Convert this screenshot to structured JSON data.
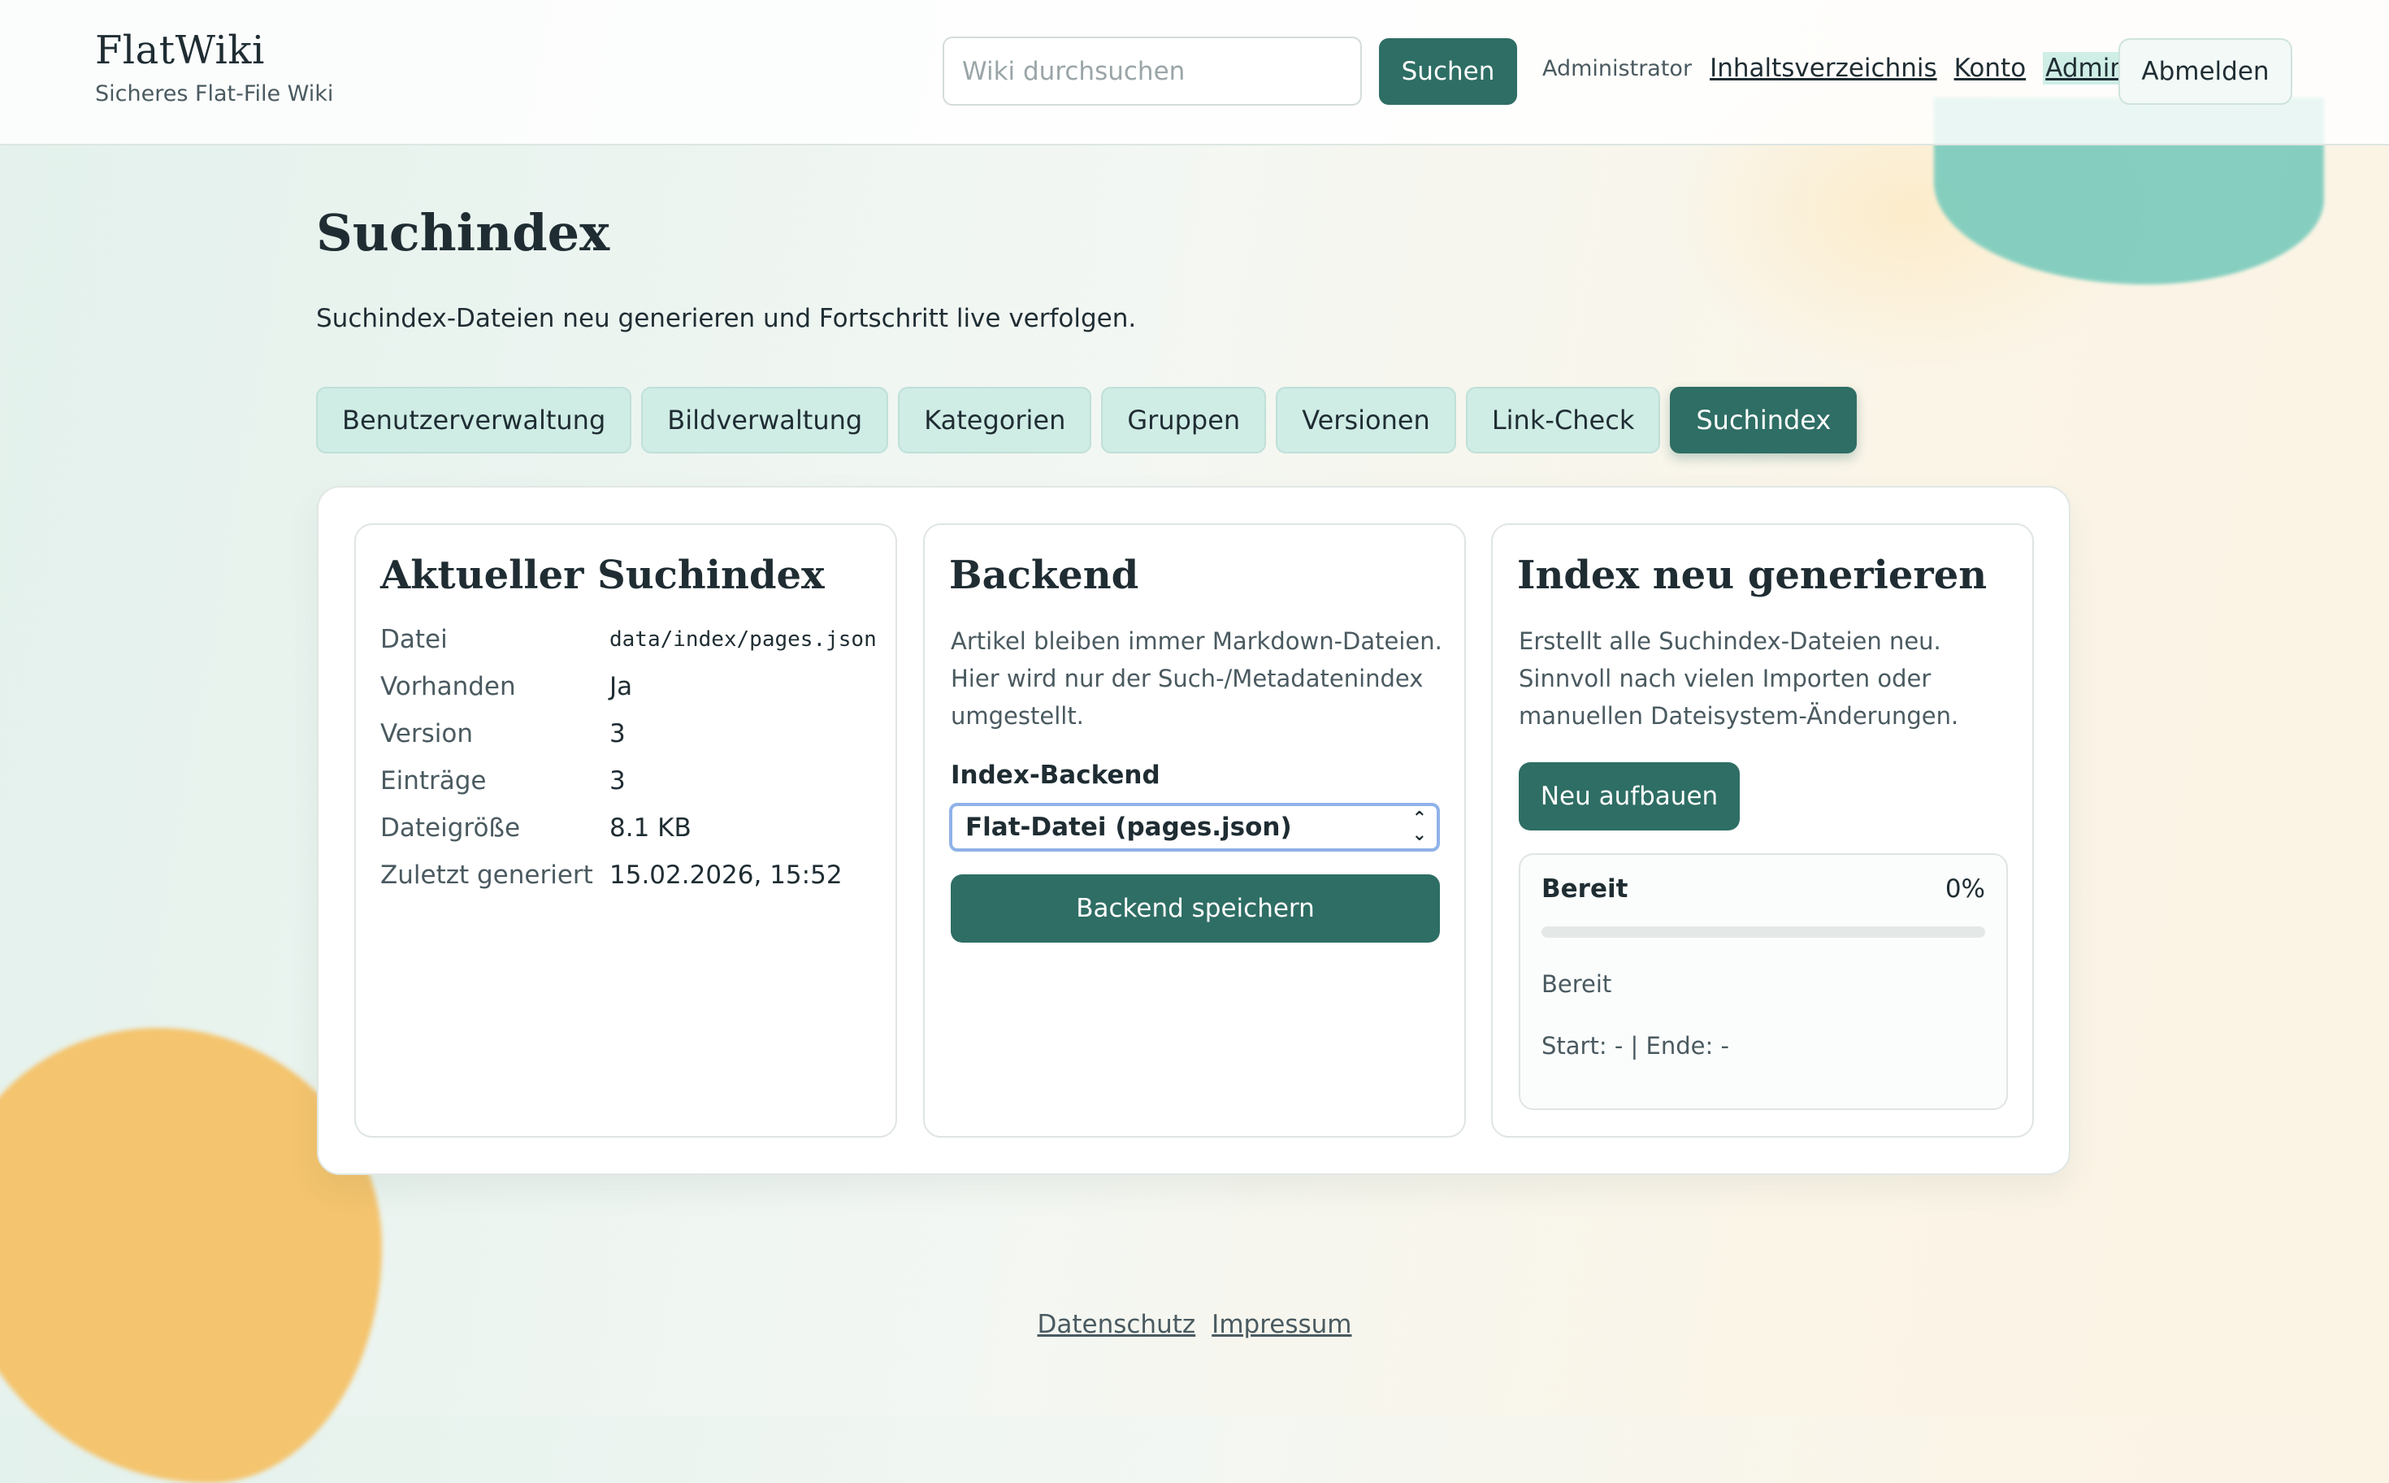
{
  "header": {
    "brand_title": "FlatWiki",
    "brand_subtitle": "Sicheres Flat-File Wiki",
    "search_placeholder": "Wiki durchsuchen",
    "search_button": "Suchen",
    "user_name": "Administrator",
    "nav_links": [
      "Inhaltsverzeichnis",
      "Konto",
      "Admin"
    ],
    "active_nav": "Admin",
    "logout_button": "Abmelden"
  },
  "page": {
    "title": "Suchindex",
    "description": "Suchindex-Dateien neu generieren und Fortschritt live verfolgen."
  },
  "tabs": [
    "Benutzerverwaltung",
    "Bildverwaltung",
    "Kategorien",
    "Gruppen",
    "Versionen",
    "Link-Check",
    "Suchindex"
  ],
  "active_tab": "Suchindex",
  "current_index": {
    "title": "Aktueller Suchindex",
    "rows": [
      {
        "key": "Datei",
        "value": "data/index/pages.json"
      },
      {
        "key": "Vorhanden",
        "value": "Ja"
      },
      {
        "key": "Version",
        "value": "3"
      },
      {
        "key": "Einträge",
        "value": "3"
      },
      {
        "key": "Dateigröße",
        "value": "8.1 KB"
      },
      {
        "key": "Zuletzt generiert",
        "value": "15.02.2026, 15:52"
      }
    ]
  },
  "backend": {
    "title": "Backend",
    "description": "Artikel bleiben immer Markdown-Dateien. Hier wird nur der Such-/Metadatenindex umgestellt.",
    "field_label": "Index-Backend",
    "selected_option": "Flat-Datei (pages.json)",
    "save_button": "Backend speichern"
  },
  "rebuild": {
    "title": "Index neu generieren",
    "description": "Erstellt alle Suchindex-Dateien neu. Sinnvoll nach vielen Importen oder manuellen Dateisystem-Änderungen.",
    "button": "Neu aufbauen",
    "status_label": "Bereit",
    "progress_percent": 0,
    "progress_text": "0%",
    "status_message": "Bereit",
    "times": "Start: - | Ende: -"
  },
  "footer": {
    "links": [
      "Datenschutz",
      "Impressum"
    ]
  },
  "colors": {
    "accent": "#2e6e64",
    "tab_bg": "#cfece5",
    "blob_teal": "#7fcdbe",
    "blob_orange": "#f4c46e"
  }
}
